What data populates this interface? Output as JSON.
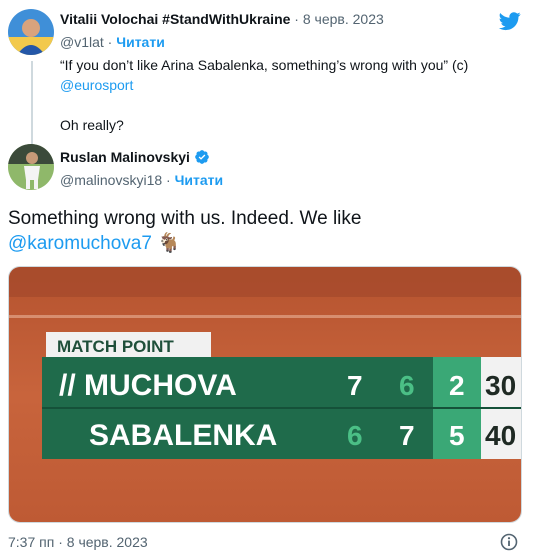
{
  "quoted_tweet": {
    "author_name": "Vitalii Volochai #StandWithUkraine",
    "separator": " · ",
    "date": "8 черв. 2023",
    "handle": "@v1lat",
    "handle_separator": " · ",
    "follow_label": "Читати",
    "text_line1": "“If you don’t like Arina Sabalenka, something’s wrong with you” (c)",
    "mention": "@eurosport",
    "text_line3": "Oh really?"
  },
  "tweet": {
    "author_name": "Ruslan Malinovskyi",
    "handle": "@malinovskyi18",
    "handle_separator": " · ",
    "follow_label": "Читати",
    "text": "Something wrong with us. Indeed. We like",
    "mention": "@karomuchova7",
    "emoji": "🐐",
    "time": "7:37 пп",
    "time_separator": " · ",
    "date": "8 черв. 2023"
  },
  "scoreboard": {
    "banner": "MATCH POINT",
    "players": [
      {
        "name": "// MUCHOVA",
        "set1": "7",
        "set2": "6",
        "set3": "2",
        "points": "30"
      },
      {
        "name": "SABALENKA",
        "set1": "6",
        "set2": "7",
        "set3": "5",
        "points": "40"
      }
    ]
  },
  "colors": {
    "accent": "#1d9bf0",
    "scoreboard_green": "#1f6b4b",
    "scoreboard_current_set": "#3aa876",
    "clay": "#c25b35"
  },
  "icons": {
    "brand": "twitter-bird-icon",
    "verified": "verified-badge-icon",
    "info": "info-icon"
  }
}
